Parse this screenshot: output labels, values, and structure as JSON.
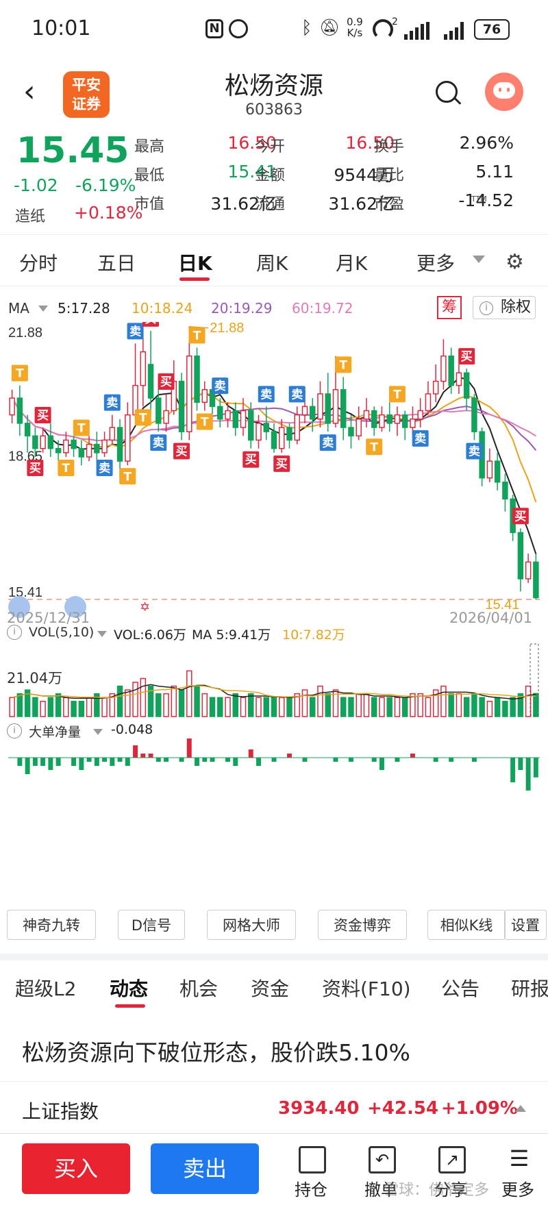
{
  "status": {
    "time": "10:01",
    "net_speed_top": "0.9",
    "net_speed_bottom": "K/s",
    "battery": "76",
    "wifi_sub": "2"
  },
  "header": {
    "title": "松炀资源",
    "code": "603863",
    "broker_line1": "平安",
    "broker_line2": "证券"
  },
  "quote": {
    "price": "15.45",
    "change": "-1.02",
    "change_pct": "-6.19%",
    "sector_name": "造纸",
    "sector_change": "+0.18%",
    "cells": [
      {
        "label": "最高",
        "value": "16.50",
        "color": "red"
      },
      {
        "label": "今开",
        "value": "16.50",
        "color": "red"
      },
      {
        "label": "换手",
        "value": "2.96%",
        "color": "black"
      },
      {
        "label": "最低",
        "value": "15.41",
        "color": "green"
      },
      {
        "label": "金额",
        "value": "9544万",
        "color": "black"
      },
      {
        "label": "量比",
        "value": "5.11",
        "color": "black"
      },
      {
        "label": "市值",
        "value": "31.62亿",
        "color": "black"
      },
      {
        "label": "流通",
        "value": "31.62亿",
        "color": "black"
      },
      {
        "label": "市盈",
        "value": "-14.52",
        "color": "black"
      }
    ],
    "pe_suffix": "TTM"
  },
  "tabs": [
    {
      "label": "分时"
    },
    {
      "label": "五日"
    },
    {
      "label": "日K"
    },
    {
      "label": "周K"
    },
    {
      "label": "月K"
    },
    {
      "label": "更多"
    }
  ],
  "ma_bar": {
    "label": "MA",
    "ma5": "5:17.28",
    "ma10": "10:18.24",
    "ma20": "20:19.29",
    "ma60": "60:19.72",
    "chip_label": "筹",
    "exright_label": "除权"
  },
  "colors": {
    "up": "#e0263b",
    "down": "#10a35b",
    "ma5": "#222222",
    "ma10": "#e8a317",
    "ma20": "#9b59b6",
    "ma60": "#e07bb5",
    "buy_tag": "#e0263b",
    "sell_tag": "#2d7dd2",
    "t_tag": "#f5a623"
  },
  "chart_data": {
    "type": "candlestick",
    "y_labels": [
      "21.88",
      "18.65",
      "15.41"
    ],
    "high_mark": "21.88",
    "low_mark": "15.41",
    "date_start": "2025/12/31",
    "date_end": "2026/04/01",
    "ylim": [
      15.41,
      21.88
    ],
    "candles": [
      [
        19.8,
        20.2,
        19.6,
        20.4
      ],
      [
        20.2,
        19.6,
        19.3,
        20.5
      ],
      [
        19.6,
        19.3,
        18.9,
        19.8
      ],
      [
        19.3,
        19.0,
        18.8,
        19.5
      ],
      [
        19.0,
        19.3,
        18.9,
        19.5
      ],
      [
        19.3,
        19.0,
        18.8,
        19.6
      ],
      [
        19.0,
        18.9,
        18.7,
        19.2
      ],
      [
        18.9,
        19.2,
        18.8,
        19.4
      ],
      [
        19.2,
        19.0,
        18.8,
        19.3
      ],
      [
        19.0,
        18.8,
        18.6,
        19.2
      ],
      [
        18.8,
        19.1,
        18.7,
        19.3
      ],
      [
        19.1,
        18.9,
        18.7,
        19.4
      ],
      [
        18.9,
        19.2,
        18.8,
        19.4
      ],
      [
        19.2,
        19.5,
        19.1,
        19.8
      ],
      [
        19.5,
        18.7,
        18.2,
        19.7
      ],
      [
        18.7,
        19.8,
        18.6,
        20.1
      ],
      [
        19.8,
        20.5,
        19.7,
        21.5
      ],
      [
        20.5,
        21.3,
        20.0,
        21.7
      ],
      [
        21.0,
        20.2,
        19.8,
        21.8
      ],
      [
        20.2,
        19.6,
        19.4,
        20.6
      ],
      [
        19.6,
        19.9,
        19.4,
        20.3
      ],
      [
        19.9,
        20.6,
        19.8,
        21.1
      ],
      [
        20.6,
        19.4,
        19.2,
        20.8
      ],
      [
        19.4,
        21.2,
        19.2,
        21.9
      ],
      [
        21.2,
        20.1,
        19.9,
        21.4
      ],
      [
        20.1,
        20.4,
        19.9,
        20.6
      ],
      [
        20.4,
        20.0,
        19.8,
        20.6
      ],
      [
        20.0,
        19.7,
        19.5,
        20.2
      ],
      [
        19.7,
        19.9,
        19.5,
        20.1
      ],
      [
        19.9,
        19.5,
        19.3,
        20.1
      ],
      [
        19.5,
        19.9,
        19.3,
        20.2
      ],
      [
        19.9,
        19.2,
        19.0,
        20.1
      ],
      [
        19.2,
        19.6,
        19.0,
        19.8
      ],
      [
        19.6,
        19.4,
        19.2,
        20.0
      ],
      [
        19.4,
        19.0,
        18.9,
        19.6
      ],
      [
        19.0,
        19.5,
        18.9,
        19.7
      ],
      [
        19.5,
        19.2,
        19.0,
        19.6
      ],
      [
        19.2,
        19.8,
        19.1,
        20.0
      ],
      [
        19.8,
        20.0,
        19.6,
        20.4
      ],
      [
        20.0,
        19.7,
        19.4,
        20.2
      ],
      [
        19.7,
        20.3,
        19.5,
        20.6
      ],
      [
        20.3,
        19.6,
        19.4,
        20.8
      ],
      [
        19.6,
        20.4,
        19.5,
        21.2
      ],
      [
        20.4,
        19.5,
        19.2,
        20.7
      ],
      [
        19.5,
        19.3,
        19.0,
        19.8
      ],
      [
        19.3,
        19.7,
        19.2,
        20.0
      ],
      [
        19.7,
        19.9,
        19.5,
        20.2
      ],
      [
        19.9,
        19.5,
        19.3,
        20.0
      ],
      [
        19.5,
        19.8,
        19.4,
        20.0
      ],
      [
        19.8,
        19.6,
        19.4,
        20.1
      ],
      [
        19.6,
        19.8,
        19.3,
        20.0
      ],
      [
        19.8,
        19.5,
        19.2,
        19.9
      ],
      [
        19.5,
        19.7,
        19.3,
        20.0
      ],
      [
        19.7,
        19.9,
        19.5,
        20.2
      ],
      [
        19.9,
        20.3,
        19.8,
        20.6
      ],
      [
        20.3,
        20.6,
        20.1,
        21.0
      ],
      [
        20.6,
        21.2,
        20.4,
        21.6
      ],
      [
        21.2,
        20.5,
        20.3,
        21.4
      ],
      [
        20.5,
        20.8,
        20.3,
        21.0
      ],
      [
        20.8,
        20.2,
        19.9,
        20.9
      ],
      [
        20.2,
        19.4,
        19.2,
        20.3
      ],
      [
        19.4,
        18.3,
        18.1,
        19.5
      ],
      [
        18.3,
        18.7,
        18.2,
        19.0
      ],
      [
        18.7,
        18.2,
        18.0,
        18.9
      ],
      [
        18.2,
        17.8,
        17.5,
        18.4
      ],
      [
        17.8,
        17.0,
        16.8,
        17.9
      ],
      [
        17.0,
        15.9,
        15.6,
        17.1
      ],
      [
        15.9,
        16.3,
        15.8,
        16.5
      ],
      [
        16.3,
        15.45,
        15.41,
        16.5
      ]
    ],
    "series_names": [
      "MA5",
      "MA10",
      "MA20",
      "MA60"
    ],
    "signals": [
      {
        "i": 1,
        "t": "T"
      },
      {
        "i": 3,
        "t": "买"
      },
      {
        "i": 4,
        "t": "买"
      },
      {
        "i": 7,
        "t": "T"
      },
      {
        "i": 9,
        "t": "T"
      },
      {
        "i": 12,
        "t": "卖"
      },
      {
        "i": 13,
        "t": "卖"
      },
      {
        "i": 15,
        "t": "T"
      },
      {
        "i": 16,
        "t": "卖"
      },
      {
        "i": 17,
        "t": "T"
      },
      {
        "i": 18,
        "t": "买"
      },
      {
        "i": 19,
        "t": "卖"
      },
      {
        "i": 20,
        "t": "买"
      },
      {
        "i": 22,
        "t": "买"
      },
      {
        "i": 24,
        "t": "T"
      },
      {
        "i": 25,
        "t": "T"
      },
      {
        "i": 27,
        "t": "卖"
      },
      {
        "i": 31,
        "t": "买"
      },
      {
        "i": 33,
        "t": "卖"
      },
      {
        "i": 35,
        "t": "买"
      },
      {
        "i": 37,
        "t": "卖"
      },
      {
        "i": 41,
        "t": "卖"
      },
      {
        "i": 43,
        "t": "T"
      },
      {
        "i": 47,
        "t": "T"
      },
      {
        "i": 50,
        "t": "T"
      },
      {
        "i": 53,
        "t": "卖"
      },
      {
        "i": 59,
        "t": "买"
      },
      {
        "i": 60,
        "t": "卖"
      },
      {
        "i": 66,
        "t": "买"
      }
    ],
    "vol_label": "VOL(5,10)",
    "vol_text": "VOL:6.06万",
    "vol_ma5": "MA 5:9.41万",
    "vol_ma10": "10:7.82万",
    "vol_max_label": "21.04万",
    "volumes": [
      5,
      6,
      7,
      5,
      4,
      5,
      6,
      5,
      4,
      4,
      5,
      6,
      5,
      6,
      8,
      7,
      9,
      10,
      8,
      6,
      6,
      8,
      7,
      12,
      8,
      6,
      5,
      5,
      5,
      6,
      5,
      6,
      5,
      5,
      5,
      5,
      5,
      6,
      7,
      5,
      8,
      6,
      7,
      5,
      5,
      6,
      6,
      5,
      5,
      5,
      5,
      5,
      6,
      6,
      5,
      7,
      8,
      6,
      6,
      5,
      6,
      5,
      4,
      5,
      4,
      5,
      6,
      8,
      6.06
    ],
    "bigorder_label": "大单净量",
    "bigorder_value": "-0.048",
    "bigorder": [
      0,
      -0.02,
      -0.04,
      -0.02,
      -0.02,
      -0.03,
      -0.02,
      0,
      -0.02,
      -0.03,
      -0.01,
      -0.02,
      -0.01,
      -0.02,
      -0.01,
      -0.02,
      0.03,
      0.01,
      0.01,
      -0.01,
      -0.01,
      0,
      -0.01,
      0.07,
      -0.02,
      -0.01,
      -0.01,
      0,
      -0.01,
      -0.02,
      0,
      0.02,
      -0.02,
      0,
      -0.01,
      0,
      0.01,
      0,
      -0.01,
      0,
      0,
      0,
      -0.01,
      0,
      -0.01,
      0,
      0,
      -0.01,
      -0.03,
      0,
      -0.01,
      0,
      0.01,
      0,
      0,
      -0.01,
      0,
      -0.01,
      0,
      0,
      -0.01,
      0,
      0,
      0,
      0,
      -0.06,
      -0.03,
      -0.08,
      -0.048
    ]
  },
  "tools": [
    "神奇九转",
    "D信号",
    "网格大师",
    "资金博弈",
    "相似K线",
    "设置"
  ],
  "subtabs": [
    {
      "label": "超级L2"
    },
    {
      "label": "动态"
    },
    {
      "label": "机会"
    },
    {
      "label": "资金"
    },
    {
      "label": "资料(F10)"
    },
    {
      "label": "公告"
    },
    {
      "label": "研报"
    }
  ],
  "news": {
    "headline": "松炀资源向下破位形态，股价跌5.10%"
  },
  "index": {
    "name": "上证指数",
    "value": "3934.40",
    "change": "+42.54",
    "pct": "+1.09%"
  },
  "bottom": {
    "buy": "买入",
    "sell": "卖出",
    "items": [
      {
        "label": "持仓"
      },
      {
        "label": "撤单"
      },
      {
        "label": "分享"
      },
      {
        "label": "更多"
      }
    ],
    "watermark": "雪球：佛爷定多"
  }
}
